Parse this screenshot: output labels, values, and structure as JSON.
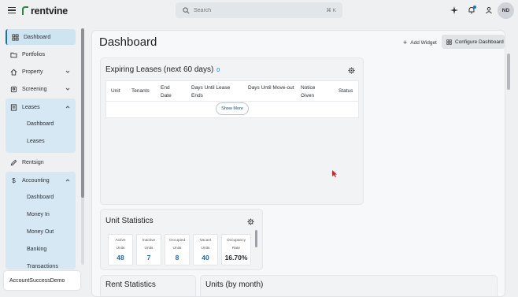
{
  "header": {
    "brand": "rentvine",
    "search_placeholder": "Search",
    "search_shortcut": "⌘ K",
    "avatar_initials": "ND",
    "icons": [
      "menu-icon",
      "sparkle-icon",
      "bell-icon",
      "user-icon"
    ]
  },
  "sidebar": {
    "items": [
      {
        "label": "Dashboard",
        "icon": "grid-icon",
        "active": true
      },
      {
        "label": "Portfolios",
        "icon": "folder-icon"
      },
      {
        "label": "Property",
        "icon": "home-icon"
      },
      {
        "label": "Screening",
        "icon": "screening-icon"
      },
      {
        "label": "Leases",
        "icon": "lease-icon"
      },
      {
        "label": "Rentsign",
        "icon": "pen-icon"
      },
      {
        "label": "Accounting",
        "icon": "dollar-icon"
      }
    ],
    "leases_sub": [
      "Dashboard",
      "Leases"
    ],
    "accounting_sub": [
      "Dashboard",
      "Money In",
      "Money Out",
      "Banking",
      "Transactions"
    ],
    "account_name": "AccountSuccessDemo"
  },
  "main": {
    "title": "Dashboard",
    "add_widget": "Add Widget",
    "configure": "Configure Dashboard",
    "expiring": {
      "title": "Expiring Leases (next 60 days)",
      "count": "0",
      "columns": [
        "Unit",
        "Tenants",
        "End Date",
        "Days Until Lease Ends",
        "Days Until Move-out",
        "Notice Given",
        "Status"
      ],
      "show_more": "Show More"
    },
    "unit_stats": {
      "title": "Unit Statistics",
      "stats": [
        {
          "l1": "Active",
          "l2": "Units",
          "value": "48"
        },
        {
          "l1": "Inactive",
          "l2": "Units",
          "value": "7"
        },
        {
          "l1": "Occupied",
          "l2": "Units",
          "value": "8"
        },
        {
          "l1": "Vacant",
          "l2": "Units",
          "value": "40"
        },
        {
          "l1": "Occupancy",
          "l2": "Rate",
          "value": "16.70%"
        }
      ]
    },
    "rent_stats_title": "Rent Statistics",
    "units_by_month_title": "Units (by month)"
  }
}
